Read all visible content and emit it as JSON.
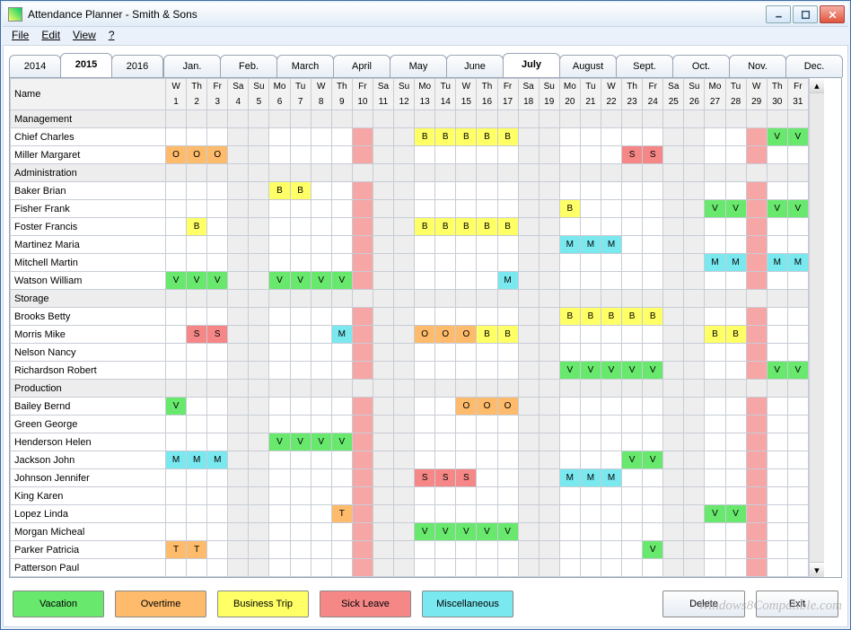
{
  "window": {
    "title": "Attendance Planner - Smith & Sons"
  },
  "menubar": [
    "File",
    "Edit",
    "View",
    "?"
  ],
  "yearTabs": [
    {
      "label": "2014",
      "sel": false
    },
    {
      "label": "2015",
      "sel": true
    },
    {
      "label": "2016",
      "sel": false
    }
  ],
  "monthTabs": [
    {
      "label": "Jan.",
      "sel": false
    },
    {
      "label": "Feb.",
      "sel": false
    },
    {
      "label": "March",
      "sel": false
    },
    {
      "label": "April",
      "sel": false
    },
    {
      "label": "May",
      "sel": false
    },
    {
      "label": "June",
      "sel": false
    },
    {
      "label": "July",
      "sel": true
    },
    {
      "label": "August",
      "sel": false
    },
    {
      "label": "Sept.",
      "sel": false
    },
    {
      "label": "Oct.",
      "sel": false
    },
    {
      "label": "Nov.",
      "sel": false
    },
    {
      "label": "Dec.",
      "sel": false
    }
  ],
  "headers": {
    "nameLabel": "Name",
    "days": [
      {
        "dow": "W",
        "num": "1"
      },
      {
        "dow": "Th",
        "num": "2"
      },
      {
        "dow": "Fr",
        "num": "3"
      },
      {
        "dow": "Sa",
        "num": "4"
      },
      {
        "dow": "Su",
        "num": "5"
      },
      {
        "dow": "Mo",
        "num": "6"
      },
      {
        "dow": "Tu",
        "num": "7"
      },
      {
        "dow": "W",
        "num": "8"
      },
      {
        "dow": "Th",
        "num": "9"
      },
      {
        "dow": "Fr",
        "num": "10"
      },
      {
        "dow": "Sa",
        "num": "11"
      },
      {
        "dow": "Su",
        "num": "12"
      },
      {
        "dow": "Mo",
        "num": "13"
      },
      {
        "dow": "Tu",
        "num": "14"
      },
      {
        "dow": "W",
        "num": "15"
      },
      {
        "dow": "Th",
        "num": "16"
      },
      {
        "dow": "Fr",
        "num": "17"
      },
      {
        "dow": "Sa",
        "num": "18"
      },
      {
        "dow": "Su",
        "num": "19"
      },
      {
        "dow": "Mo",
        "num": "20"
      },
      {
        "dow": "Tu",
        "num": "21"
      },
      {
        "dow": "W",
        "num": "22"
      },
      {
        "dow": "Th",
        "num": "23"
      },
      {
        "dow": "Fr",
        "num": "24"
      },
      {
        "dow": "Sa",
        "num": "25"
      },
      {
        "dow": "Su",
        "num": "26"
      },
      {
        "dow": "Mo",
        "num": "27"
      },
      {
        "dow": "Tu",
        "num": "28"
      },
      {
        "dow": "W",
        "num": "29"
      },
      {
        "dow": "Th",
        "num": "30"
      },
      {
        "dow": "Fr",
        "num": "31"
      }
    ]
  },
  "weekendIdx": [
    3,
    4,
    10,
    11,
    17,
    18,
    24,
    25
  ],
  "holidayIdx": [
    9,
    28
  ],
  "rows": [
    {
      "group": true,
      "name": "Management"
    },
    {
      "name": "Chief Charles",
      "cells": {
        "12": "B",
        "13": "B",
        "14": "B",
        "15": "B",
        "16": "B",
        "29": "V",
        "30": "V"
      }
    },
    {
      "name": "Miller Margaret",
      "cells": {
        "0": "O",
        "1": "O",
        "2": "O",
        "22": "S",
        "23": "S"
      }
    },
    {
      "group": true,
      "name": "Administration"
    },
    {
      "name": "Baker Brian",
      "cells": {
        "5": "B",
        "6": "B"
      }
    },
    {
      "name": "Fisher Frank",
      "cells": {
        "19": "B",
        "26": "V",
        "27": "V",
        "29": "V",
        "30": "V"
      }
    },
    {
      "name": "Foster Francis",
      "cells": {
        "1": "B",
        "12": "B",
        "13": "B",
        "14": "B",
        "15": "B",
        "16": "B"
      }
    },
    {
      "name": "Martinez Maria",
      "cells": {
        "19": "M",
        "20": "M",
        "21": "M"
      }
    },
    {
      "name": "Mitchell Martin",
      "cells": {
        "26": "M",
        "27": "M",
        "29": "M",
        "30": "M"
      }
    },
    {
      "name": "Watson William",
      "cells": {
        "0": "V",
        "1": "V",
        "2": "V",
        "5": "V",
        "6": "V",
        "7": "V",
        "8": "V",
        "16": "M"
      }
    },
    {
      "group": true,
      "name": "Storage"
    },
    {
      "name": "Brooks Betty",
      "cells": {
        "19": "B",
        "20": "B",
        "21": "B",
        "22": "B",
        "23": "B"
      }
    },
    {
      "name": "Morris Mike",
      "cells": {
        "1": "S",
        "2": "S",
        "8": "M",
        "12": "O",
        "13": "O",
        "14": "O",
        "15": "B",
        "16": "B",
        "26": "B",
        "27": "B"
      }
    },
    {
      "name": "Nelson Nancy",
      "cells": {}
    },
    {
      "name": "Richardson Robert",
      "cells": {
        "19": "V",
        "20": "V",
        "21": "V",
        "22": "V",
        "23": "V",
        "29": "V",
        "30": "V"
      }
    },
    {
      "group": true,
      "name": "Production"
    },
    {
      "name": "Bailey Bernd",
      "cells": {
        "0": "V",
        "14": "O",
        "15": "O",
        "16": "O"
      }
    },
    {
      "name": "Green George",
      "cells": {}
    },
    {
      "name": "Henderson Helen",
      "cells": {
        "5": "V",
        "6": "V",
        "7": "V",
        "8": "V"
      }
    },
    {
      "name": "Jackson John",
      "cells": {
        "0": "M",
        "1": "M",
        "2": "M",
        "22": "V",
        "23": "V"
      }
    },
    {
      "name": "Johnson Jennifer",
      "cells": {
        "12": "S",
        "13": "S",
        "14": "S",
        "19": "M",
        "20": "M",
        "21": "M"
      }
    },
    {
      "name": "King Karen",
      "cells": {}
    },
    {
      "name": "Lopez Linda",
      "cells": {
        "8": "T",
        "26": "V",
        "27": "V"
      }
    },
    {
      "name": "Morgan Micheal",
      "cells": {
        "12": "V",
        "13": "V",
        "14": "V",
        "15": "V",
        "16": "V"
      }
    },
    {
      "name": "Parker Patricia",
      "cells": {
        "0": "T",
        "1": "T",
        "23": "V"
      }
    },
    {
      "name": "Patterson Paul",
      "cells": {}
    }
  ],
  "legend": [
    {
      "code": "V",
      "label": "Vacation"
    },
    {
      "code": "O",
      "label": "Overtime"
    },
    {
      "code": "B",
      "label": "Business Trip"
    },
    {
      "code": "S",
      "label": "Sick Leave"
    },
    {
      "code": "M",
      "label": "Miscellaneous"
    }
  ],
  "buttons": {
    "delete": "Delete",
    "exit": "Exit"
  },
  "watermark": "Windows8Compatible.com"
}
